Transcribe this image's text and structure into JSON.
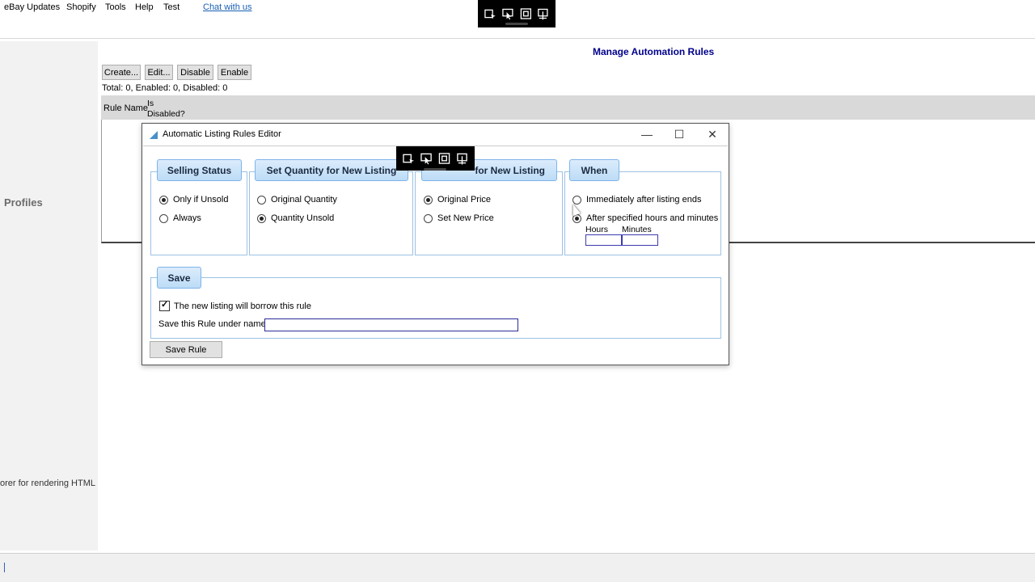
{
  "menu": {
    "items": [
      "eBay Updates",
      "Shopify",
      "Tools",
      "Help",
      "Test"
    ],
    "chat_link": "Chat with us"
  },
  "sidebar": {
    "profiles_label": "Profiles",
    "render_label": "orer for rendering HTML"
  },
  "main": {
    "title": "Manage Automation Rules",
    "toolbar": {
      "create": "Create...",
      "edit": "Edit...",
      "disable": "Disable",
      "enable": "Enable"
    },
    "counts": "Total: 0, Enabled: 0, Disabled: 0",
    "columns": {
      "rule_name": "Rule Name",
      "is_disabled": "Is Disabled?"
    }
  },
  "dialog": {
    "title": "Automatic Listing Rules Editor",
    "window_buttons": {
      "minimize": "—",
      "maximize": "☐",
      "close": "✕"
    },
    "selling_status": {
      "header": "Selling Status",
      "options": [
        {
          "label": "Only if Unsold",
          "checked": true
        },
        {
          "label": "Always",
          "checked": false
        }
      ]
    },
    "quantity": {
      "header": "Set Quantity for New Listing",
      "options": [
        {
          "label": "Original Quantity",
          "checked": false
        },
        {
          "label": "Quantity Unsold",
          "checked": true
        }
      ]
    },
    "price": {
      "header": "for New Listing",
      "options": [
        {
          "label": "Original Price",
          "checked": true
        },
        {
          "label": "Set New Price",
          "checked": false
        }
      ]
    },
    "when": {
      "header": "When",
      "options": [
        {
          "label": "Immediately after listing ends",
          "checked": false
        },
        {
          "label": "After specified hours and minutes",
          "checked": true
        }
      ],
      "hours_label": "Hours",
      "minutes_label": "Minutes",
      "hours_value": "",
      "minutes_value": ""
    },
    "save": {
      "header": "Save",
      "borrow_label": "The new listing will borrow this rule",
      "borrow_checked": true,
      "name_label": "Save this Rule under name:",
      "name_value": "",
      "save_button": "Save Rule"
    }
  },
  "colors": {
    "title_blue": "#00008b",
    "group_tab_fill": "#bcdcf6",
    "group_border": "#9cc2e5"
  },
  "capture_toolbar_icons": [
    "record-region-icon",
    "pointer-icon",
    "fullscreen-icon",
    "settings-icon"
  ]
}
